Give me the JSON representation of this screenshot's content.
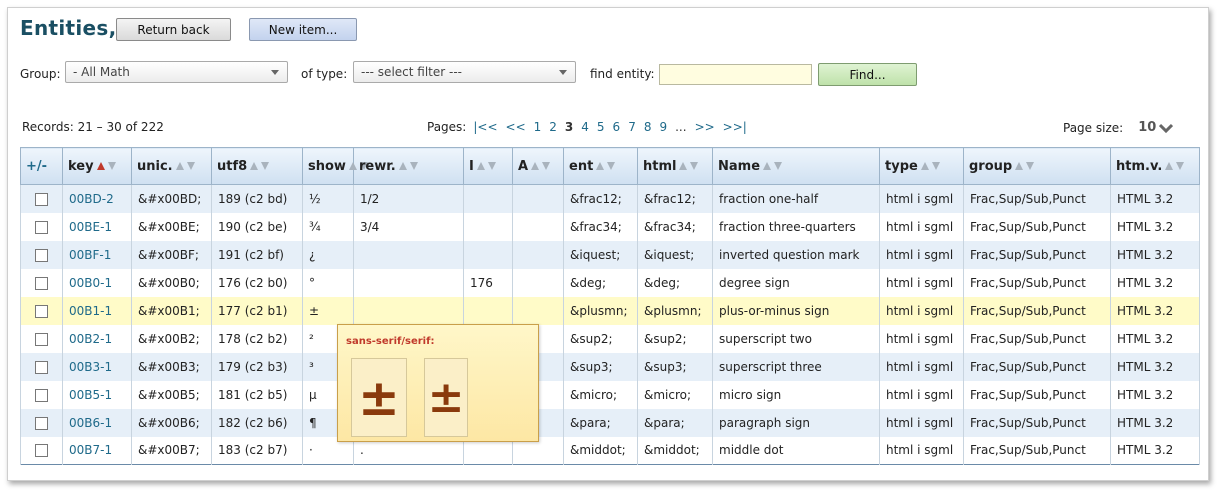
{
  "title": "Entities,",
  "buttons": {
    "return_back": "Return back",
    "new_item": "New item...",
    "find": "Find..."
  },
  "filters": {
    "group_label": "Group:",
    "group_value": "- All Math",
    "type_label": "of type:",
    "type_value": "--- select filter ---",
    "find_label": "find entity:",
    "find_value": ""
  },
  "records": "Records: 21 – 30 of 222",
  "pager": {
    "label": "Pages:",
    "first": "|<<",
    "prev": "<<",
    "p1": "1",
    "p2": "2",
    "current": "3",
    "p4": "4",
    "p5": "5",
    "p6": "6",
    "p7": "7",
    "p8": "8",
    "p9": "9",
    "dots": "...",
    "next": ">>",
    "last": ">>|"
  },
  "page_size": {
    "label": "Page size:",
    "value": "10"
  },
  "columns": [
    "+/-",
    "key",
    "unic.",
    "utf8",
    "show",
    "rewr.",
    "I",
    "A",
    "ent",
    "html",
    "Name",
    "type",
    "group",
    "htm.v."
  ],
  "rows": [
    {
      "key": "00BD-2",
      "unic": "&#x00BD;",
      "utf8": "189 (c2 bd)",
      "show": "½",
      "rewr": "1/2",
      "i": "",
      "a": "",
      "ent": "&frac12;",
      "html": "&frac12;",
      "name": "fraction one-half",
      "type": "html i sgml",
      "group": "Frac,Sup/Sub,Punct",
      "htmv": "HTML 3.2"
    },
    {
      "key": "00BE-1",
      "unic": "&#x00BE;",
      "utf8": "190 (c2 be)",
      "show": "¾",
      "rewr": "3/4",
      "i": "",
      "a": "",
      "ent": "&frac34;",
      "html": "&frac34;",
      "name": "fraction three-quarters",
      "type": "html i sgml",
      "group": "Frac,Sup/Sub,Punct",
      "htmv": "HTML 3.2"
    },
    {
      "key": "00BF-1",
      "unic": "&#x00BF;",
      "utf8": "191 (c2 bf)",
      "show": "¿",
      "rewr": "",
      "i": "",
      "a": "",
      "ent": "&iquest;",
      "html": "&iquest;",
      "name": "inverted question mark",
      "type": "html i sgml",
      "group": "Frac,Sup/Sub,Punct",
      "htmv": "HTML 3.2"
    },
    {
      "key": "00B0-1",
      "unic": "&#x00B0;",
      "utf8": "176 (c2 b0)",
      "show": "°",
      "rewr": "",
      "i": "176",
      "a": "",
      "ent": "&deg;",
      "html": "&deg;",
      "name": "degree sign",
      "type": "html i sgml",
      "group": "Frac,Sup/Sub,Punct",
      "htmv": "HTML 3.2"
    },
    {
      "key": "00B1-1",
      "unic": "&#x00B1;",
      "utf8": "177 (c2 b1)",
      "show": "±",
      "rewr": "",
      "i": "",
      "a": "",
      "ent": "&plusmn;",
      "html": "&plusmn;",
      "name": "plus-or-minus sign",
      "type": "html i sgml",
      "group": "Frac,Sup/Sub,Punct",
      "htmv": "HTML 3.2"
    },
    {
      "key": "00B2-1",
      "unic": "&#x00B2;",
      "utf8": "178 (c2 b2)",
      "show": "²",
      "rewr": "",
      "i": "",
      "a": "",
      "ent": "&sup2;",
      "html": "&sup2;",
      "name": "superscript two",
      "type": "html i sgml",
      "group": "Frac,Sup/Sub,Punct",
      "htmv": "HTML 3.2"
    },
    {
      "key": "00B3-1",
      "unic": "&#x00B3;",
      "utf8": "179 (c2 b3)",
      "show": "³",
      "rewr": "",
      "i": "",
      "a": "",
      "ent": "&sup3;",
      "html": "&sup3;",
      "name": "superscript three",
      "type": "html i sgml",
      "group": "Frac,Sup/Sub,Punct",
      "htmv": "HTML 3.2"
    },
    {
      "key": "00B5-1",
      "unic": "&#x00B5;",
      "utf8": "181 (c2 b5)",
      "show": "µ",
      "rewr": "",
      "i": "",
      "a": "",
      "ent": "&micro;",
      "html": "&micro;",
      "name": "micro sign",
      "type": "html i sgml",
      "group": "Frac,Sup/Sub,Punct",
      "htmv": "HTML 3.2"
    },
    {
      "key": "00B6-1",
      "unic": "&#x00B6;",
      "utf8": "182 (c2 b6)",
      "show": "¶",
      "rewr": "",
      "i": "",
      "a": "",
      "ent": "&para;",
      "html": "&para;",
      "name": "paragraph sign",
      "type": "html i sgml",
      "group": "Frac,Sup/Sub,Punct",
      "htmv": "HTML 3.2"
    },
    {
      "key": "00B7-1",
      "unic": "&#x00B7;",
      "utf8": "183 (c2 b7)",
      "show": "·",
      "rewr": ".",
      "i": "",
      "a": "",
      "ent": "&middot;",
      "html": "&middot;",
      "name": "middle dot",
      "type": "html i sgml",
      "group": "Frac,Sup/Sub,Punct",
      "htmv": "HTML 3.2"
    }
  ],
  "highlighted_row_index": 4,
  "popup": {
    "title": "sans-serif/serif:",
    "glyph_sans": "±",
    "glyph_serif": "±"
  },
  "colors": {
    "title": "#1a4f63",
    "link": "#1f6a8a",
    "sort_active": "#c0392b",
    "highlight_row": "#fffbc8"
  }
}
